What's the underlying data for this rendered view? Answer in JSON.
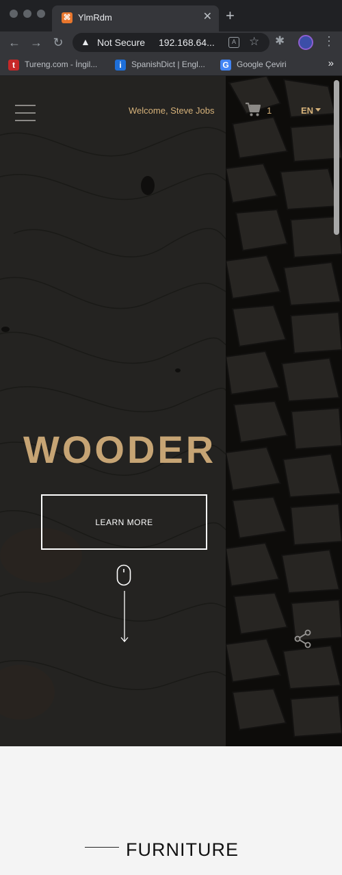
{
  "browser": {
    "tab_title": "YlmRdm",
    "tab_favicon": "⌘",
    "new_tab": "+",
    "security_label": "Not Secure",
    "url": "192.168.64...",
    "bookmarks": [
      {
        "favicon": "t",
        "favicon_color": "#c62828",
        "label": "Tureng.com - İngil..."
      },
      {
        "favicon": "i",
        "favicon_color": "#1e6fd9",
        "label": "SpanishDict | Engl..."
      },
      {
        "favicon": "G",
        "favicon_color": "#4285f4",
        "label": "Google Çeviri"
      }
    ],
    "bookmarks_more": "»"
  },
  "header": {
    "welcome": "Welcome, Steve Jobs",
    "cart_count": "1",
    "language": "EN"
  },
  "hero": {
    "brand": "WOODER",
    "cta_label": "LEARN MORE"
  },
  "section": {
    "title": "FURNITURE"
  },
  "colors": {
    "accent": "#d6b27a",
    "brand_text": "#c6a474",
    "hero_bg": "#262523"
  },
  "icons": {
    "back": "arrow-left-icon",
    "forward": "arrow-right-icon",
    "reload": "reload-icon",
    "menu": "hamburger-icon",
    "cart": "cart-icon",
    "scroll": "mouse-icon",
    "share": "share-icon"
  }
}
